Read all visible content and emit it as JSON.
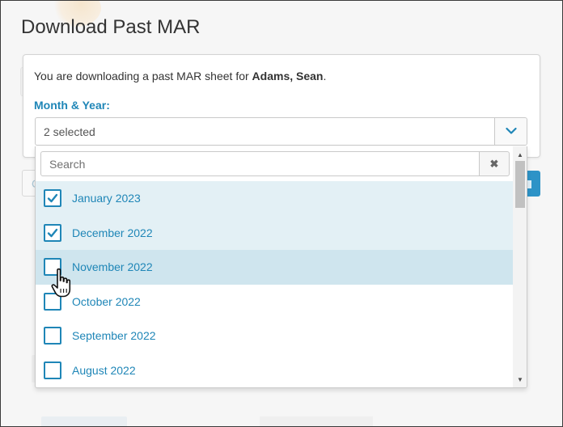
{
  "page": {
    "title": "Download Past MAR"
  },
  "card": {
    "intro_prefix": "You are downloading a past MAR sheet for ",
    "patient_name": "Adams, Sean",
    "intro_suffix": "."
  },
  "month_year": {
    "label": "Month & Year:",
    "selected_text": "2 selected"
  },
  "dropdown": {
    "search_placeholder": "Search",
    "clear_symbol": "✖",
    "options": [
      {
        "label": "January 2023",
        "checked": true
      },
      {
        "label": "December 2022",
        "checked": true
      },
      {
        "label": "November 2022",
        "checked": false
      },
      {
        "label": "October 2022",
        "checked": false
      },
      {
        "label": "September 2022",
        "checked": false
      },
      {
        "label": "August 2022",
        "checked": false
      }
    ]
  },
  "colors": {
    "accent": "#1f86b7",
    "selected_row": "#e3f0f5",
    "hover_row": "#cfe5ee",
    "title_text": "#333333"
  },
  "icons": {
    "toggle": "chevron-down-icon",
    "clear": "close-icon",
    "check": "check-icon",
    "cursor": "hand-pointer-icon"
  }
}
